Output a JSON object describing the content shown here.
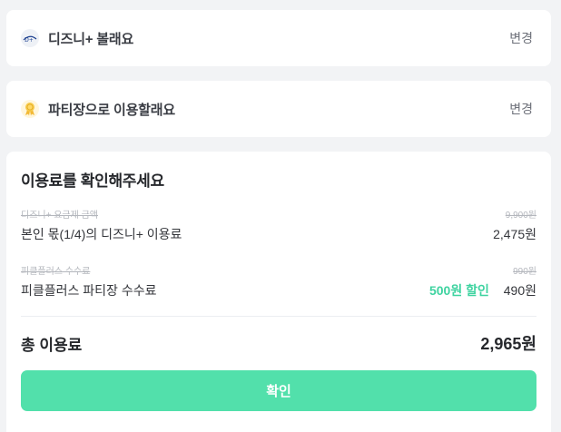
{
  "service": {
    "icon": "disney-plus-logo-icon",
    "title": "디즈니+ 볼래요",
    "change_label": "변경"
  },
  "role": {
    "icon": "medal-icon",
    "title": "파티장으로 이용할래요",
    "change_label": "변경"
  },
  "fee": {
    "title": "이용료를 확인해주세요",
    "subscription": {
      "original_label": "디즈니+ 요금제 금액",
      "original_price": "9,900원",
      "label": "본인 몫(1/4)의 디즈니+ 이용료",
      "price": "2,475원"
    },
    "commission": {
      "original_label": "피클플러스 수수료",
      "original_price": "990원",
      "label": "피클플러스 파티장 수수료",
      "discount": "500원 할인",
      "price": "490원"
    },
    "total_label": "총 이용료",
    "total_value": "2,965원"
  },
  "confirm_label": "확인",
  "colors": {
    "accent": "#52e0ab",
    "discount": "#3ed3a0",
    "background": "#f2f3f5"
  }
}
